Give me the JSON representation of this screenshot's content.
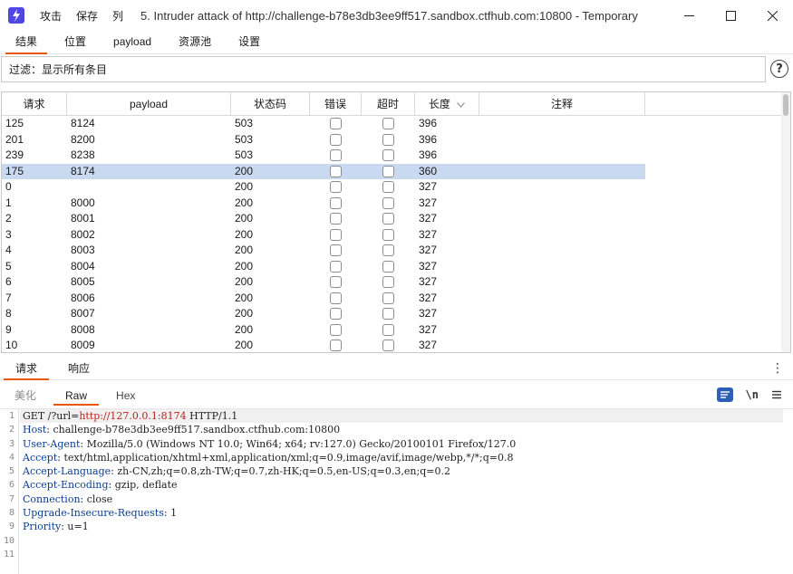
{
  "titlebar": {
    "menu": [
      "攻击",
      "保存",
      "列"
    ],
    "title": "5. Intruder attack of http://challenge-b78e3db3ee9ff517.sandbox.ctfhub.com:10800 - Temporary"
  },
  "main_tabs": [
    "结果",
    "位置",
    "payload",
    "资源池",
    "设置"
  ],
  "filter": {
    "text": "过滤：显示所有条目"
  },
  "table": {
    "headers": [
      "请求",
      "payload",
      "状态码",
      "错误",
      "超时",
      "长度",
      "注释"
    ],
    "sort_column": "长度",
    "rows": [
      {
        "req": "125",
        "payload": "8124",
        "status": "503",
        "length": "396"
      },
      {
        "req": "201",
        "payload": "8200",
        "status": "503",
        "length": "396"
      },
      {
        "req": "239",
        "payload": "8238",
        "status": "503",
        "length": "396"
      },
      {
        "req": "175",
        "payload": "8174",
        "status": "200",
        "length": "360",
        "selected": true
      },
      {
        "req": "0",
        "payload": "",
        "status": "200",
        "length": "327"
      },
      {
        "req": "1",
        "payload": "8000",
        "status": "200",
        "length": "327"
      },
      {
        "req": "2",
        "payload": "8001",
        "status": "200",
        "length": "327"
      },
      {
        "req": "3",
        "payload": "8002",
        "status": "200",
        "length": "327"
      },
      {
        "req": "4",
        "payload": "8003",
        "status": "200",
        "length": "327"
      },
      {
        "req": "5",
        "payload": "8004",
        "status": "200",
        "length": "327"
      },
      {
        "req": "6",
        "payload": "8005",
        "status": "200",
        "length": "327"
      },
      {
        "req": "7",
        "payload": "8006",
        "status": "200",
        "length": "327"
      },
      {
        "req": "8",
        "payload": "8007",
        "status": "200",
        "length": "327"
      },
      {
        "req": "9",
        "payload": "8008",
        "status": "200",
        "length": "327"
      },
      {
        "req": "10",
        "payload": "8009",
        "status": "200",
        "length": "327"
      }
    ]
  },
  "bottom_tabs": [
    "请求",
    "响应"
  ],
  "editor_tabs": [
    "美化",
    "Raw",
    "Hex"
  ],
  "editor_tools": {
    "newline_label": "\\n"
  },
  "request": {
    "line_numbers": [
      "1",
      "2",
      "3",
      "4",
      "5",
      "6",
      "7",
      "8",
      "9",
      "10",
      "11"
    ],
    "request_line": {
      "prefix": "GET /?url=",
      "url": "http://127.0.0.1:8174",
      "suffix": " HTTP/1.1"
    },
    "headers": [
      {
        "key": "Host",
        "value": "challenge-b78e3db3ee9ff517.sandbox.ctfhub.com:10800"
      },
      {
        "key": "User-Agent",
        "value": "Mozilla/5.0 (Windows NT 10.0; Win64; x64; rv:127.0) Gecko/20100101 Firefox/127.0"
      },
      {
        "key": "Accept",
        "value": "text/html,application/xhtml+xml,application/xml;q=0.9,image/avif,image/webp,*/*;q=0.8"
      },
      {
        "key": "Accept-Language",
        "value": "zh-CN,zh;q=0.8,zh-TW;q=0.7,zh-HK;q=0.5,en-US;q=0.3,en;q=0.2"
      },
      {
        "key": "Accept-Encoding",
        "value": "gzip, deflate"
      },
      {
        "key": "Connection",
        "value": "close"
      },
      {
        "key": "Upgrade-Insecure-Requests",
        "value": "1"
      },
      {
        "key": "Priority",
        "value": "u=1"
      }
    ]
  },
  "colors": {
    "accent": "#e8590c",
    "selection": "#c8d9f0",
    "logo": "#4f46e5",
    "header_key": "#0b3d91",
    "url": "#b3261e"
  }
}
